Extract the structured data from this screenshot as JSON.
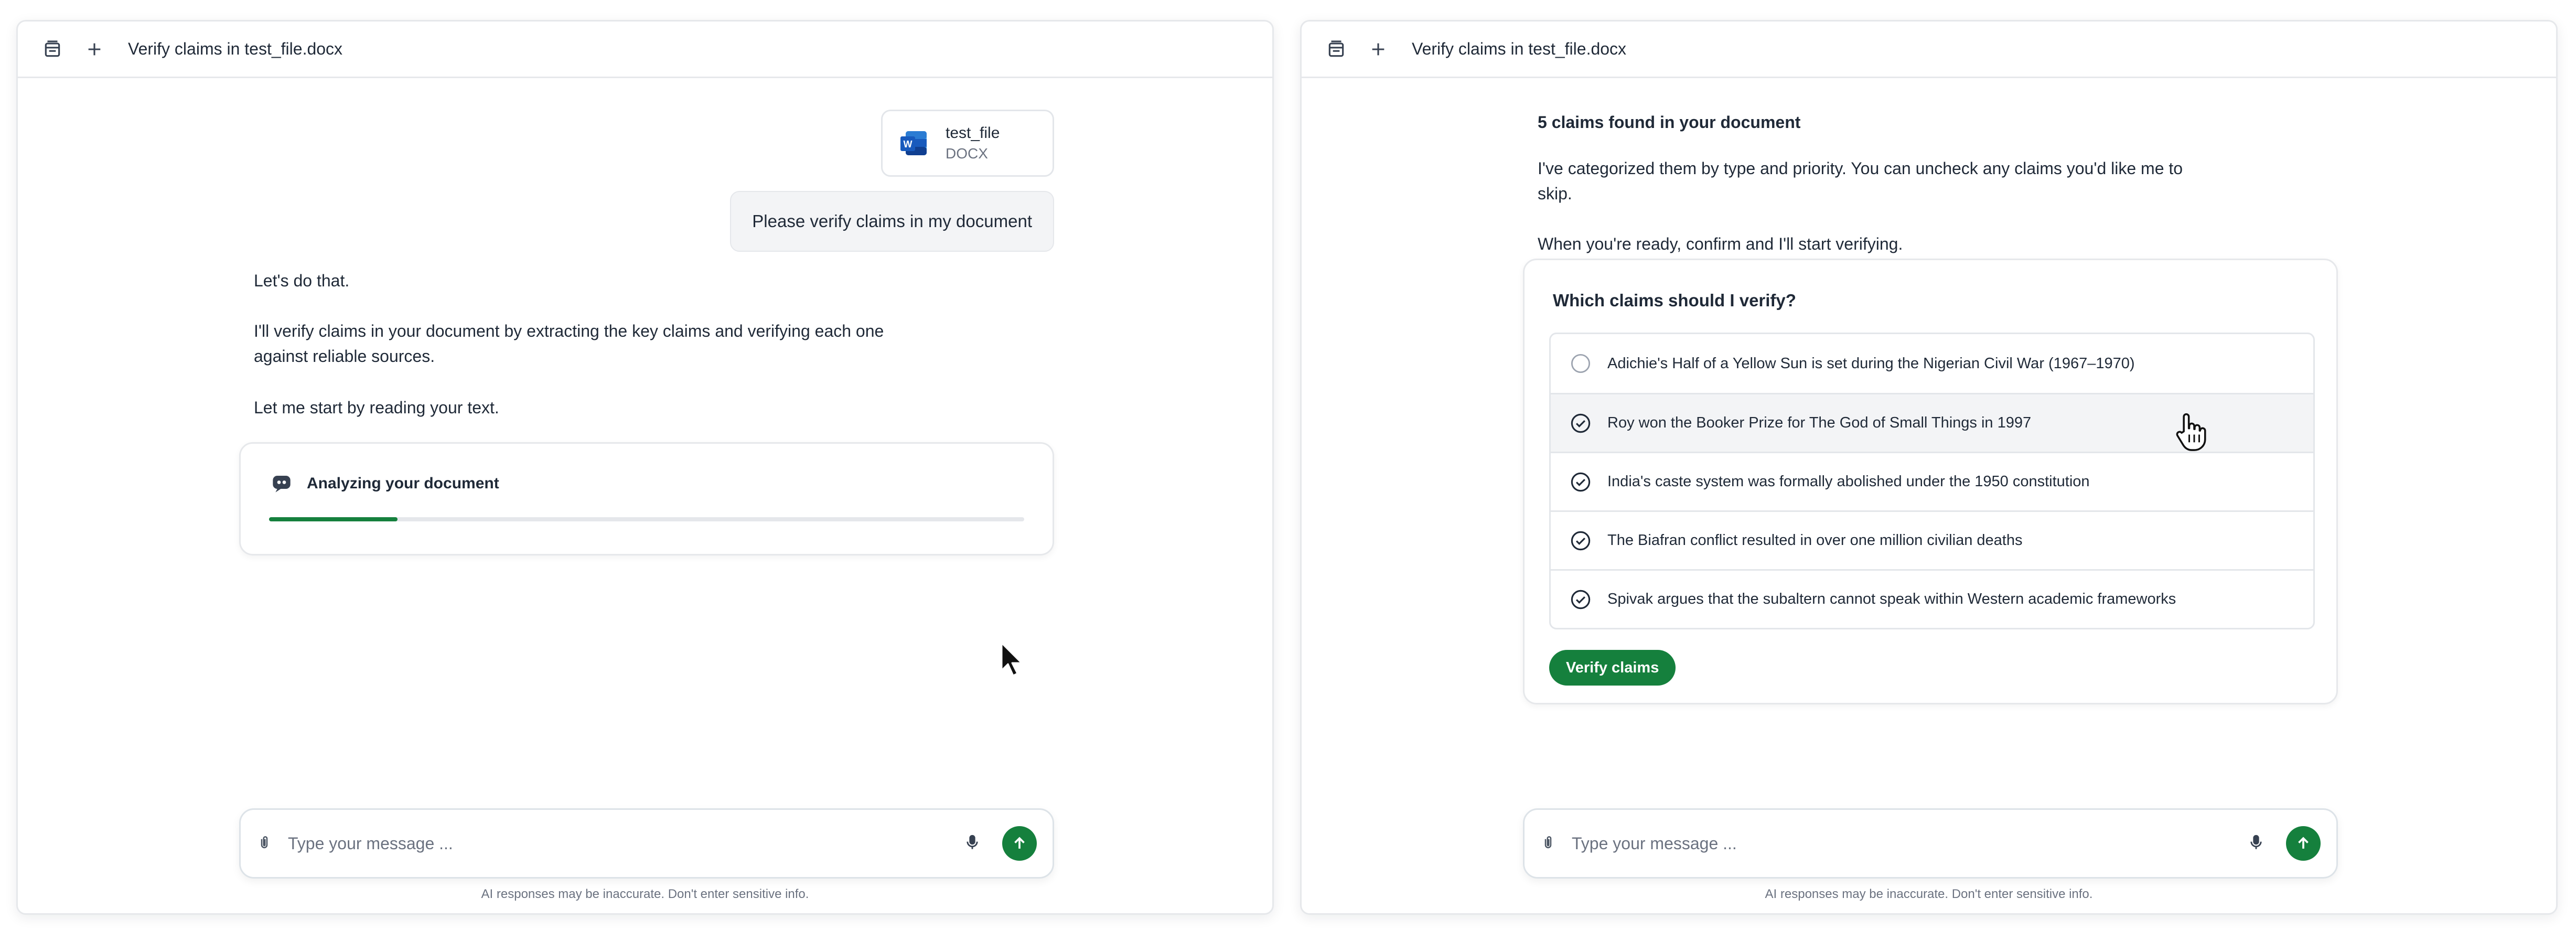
{
  "left": {
    "header": {
      "title": "Verify claims in test_file.docx"
    },
    "attachment": {
      "name": "test_file",
      "type": "DOCX"
    },
    "user_message": "Please verify claims in my document",
    "bot": {
      "line1": "Let's do that.",
      "line2": "I'll verify claims in your document by extracting the key claims and verifying each one against reliable sources.",
      "line3": "Let me start by reading your text."
    },
    "status_card": {
      "label": "Analyzing your document",
      "progress_percent": 17
    },
    "composer": {
      "placeholder": "Type your message ..."
    },
    "disclaimer": "AI responses may be inaccurate. Don't enter sensitive info."
  },
  "right": {
    "header": {
      "title": "Verify claims in test_file.docx"
    },
    "summary": {
      "heading": "5 claims found in your document",
      "p1": "I've categorized them by type and priority. You can uncheck any claims you'd like me to skip.",
      "p2": "When you're ready, confirm and I'll start verifying."
    },
    "claims": {
      "question": "Which claims should I verify?",
      "items": [
        {
          "text": "Adichie's Half of a Yellow Sun is set during the Nigerian Civil War (1967–1970)",
          "checked": false
        },
        {
          "text": "Roy won the Booker Prize for The God of Small Things in 1997",
          "checked": true
        },
        {
          "text": "India's caste system was formally abolished under the 1950 constitution",
          "checked": true
        },
        {
          "text": "The Biafran conflict resulted in over one million civilian deaths",
          "checked": true
        },
        {
          "text": "Spivak argues that the subaltern cannot speak within Western academic frameworks",
          "checked": true
        }
      ],
      "button": "Verify claims"
    },
    "composer": {
      "placeholder": "Type your message ..."
    },
    "disclaimer": "AI responses may be inaccurate. Don't enter sensitive info."
  },
  "colors": {
    "accent": "#15803d",
    "border": "#e6e8eb",
    "text": "#1f2937",
    "muted": "#6b7280"
  }
}
